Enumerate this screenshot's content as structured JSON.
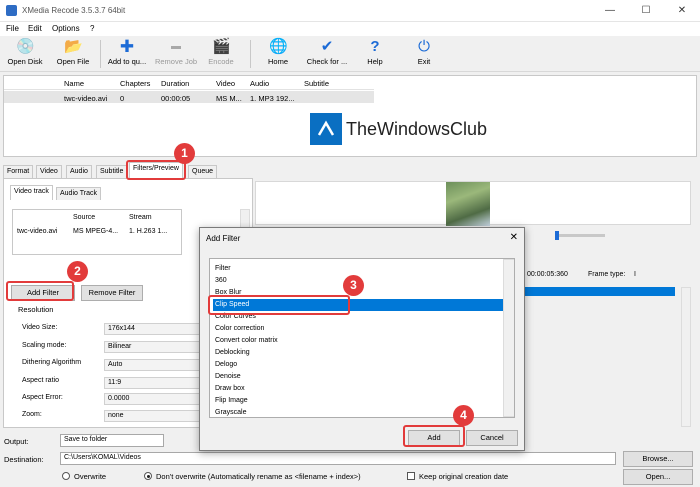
{
  "window": {
    "title": "XMedia Recode 3.5.3.7 64bit",
    "minimize": "—",
    "maximize": "☐",
    "close": "✕"
  },
  "menu": [
    "File",
    "Edit",
    "Options",
    "?"
  ],
  "toolbar": [
    {
      "label": "Open Disk",
      "icon": "disc-icon",
      "glyph": "💿",
      "enabled": true
    },
    {
      "label": "Open File",
      "icon": "folder-icon",
      "glyph": "📂",
      "enabled": true
    },
    {
      "label": "Add to qu...",
      "icon": "plus-icon",
      "glyph": "✚",
      "enabled": true
    },
    {
      "label": "Remove Job",
      "icon": "minus-icon",
      "glyph": "▬",
      "enabled": false
    },
    {
      "label": "Encode",
      "icon": "clapper-icon",
      "glyph": "🎬",
      "enabled": false
    },
    {
      "label": "Home",
      "icon": "globe-icon",
      "glyph": "🌐",
      "enabled": true
    },
    {
      "label": "Check for ...",
      "icon": "check-arrow-icon",
      "glyph": "✔",
      "enabled": true
    },
    {
      "label": "Help",
      "icon": "question-icon",
      "glyph": "?",
      "enabled": true
    },
    {
      "label": "Exit",
      "icon": "power-icon",
      "glyph": "⏻",
      "enabled": true
    }
  ],
  "file_list": {
    "columns": [
      "Name",
      "Chapters",
      "Duration",
      "Video",
      "Audio",
      "Subtitle"
    ],
    "rows": [
      [
        "twc-video.avi",
        "0",
        "00:00:05",
        "MS M...",
        "1. MP3 192...",
        ""
      ]
    ]
  },
  "watermark": "TheWindowsClub",
  "tabs": [
    "Format",
    "Video",
    "Audio",
    "Subtitle",
    "Filters/Preview",
    "Queue"
  ],
  "subtabs": [
    "Video track",
    "Audio Track"
  ],
  "streams": {
    "columns": [
      "Source",
      "Stream"
    ],
    "row": [
      "twc-video.avi",
      "MS MPEG-4...",
      "1. H.263 1..."
    ]
  },
  "buttons": {
    "add_filter": "Add Filter",
    "remove_filter": "Remove Filter"
  },
  "resolution": {
    "title": "Resolution",
    "props": [
      {
        "label": "Video Size:",
        "value": "176x144"
      },
      {
        "label": "Scaling mode:",
        "value": "Bilinear"
      },
      {
        "label": "Dithering Algorithm",
        "value": "Auto"
      },
      {
        "label": "Aspect ratio",
        "value": "11:9"
      },
      {
        "label": "Aspect Error:",
        "value": "0.0000"
      },
      {
        "label": "Zoom:",
        "value": "none"
      }
    ]
  },
  "preview_info": {
    "time": "00:00:05:360",
    "frame_type_label": "Frame type:",
    "frame_type_value": "I"
  },
  "bottom": {
    "output_label": "Output:",
    "output_value": "Save to folder",
    "destination_label": "Destination:",
    "destination_value": "C:\\Users\\KOMAL\\Videos",
    "browse": "Browse...",
    "open": "Open...",
    "overwrite": "Overwrite",
    "dont_overwrite": "Don't overwrite (Automatically rename as <filename + index>)",
    "keep_date": "Keep original creation date"
  },
  "dialog": {
    "title": "Add Filter",
    "close": "✕",
    "list_header": "Filter",
    "items": [
      "360",
      "Box Blur",
      "Clip Speed",
      "Color Curves",
      "Color correction",
      "Convert color matrix",
      "Deblocking",
      "Delogo",
      "Denoise",
      "Draw box",
      "Flip Image",
      "Grayscale"
    ],
    "selected_index": 2,
    "add": "Add",
    "cancel": "Cancel"
  },
  "badges": [
    "1",
    "2",
    "3",
    "4"
  ],
  "colors": {
    "callout": "#e23b3b",
    "selection": "#0078d7"
  }
}
